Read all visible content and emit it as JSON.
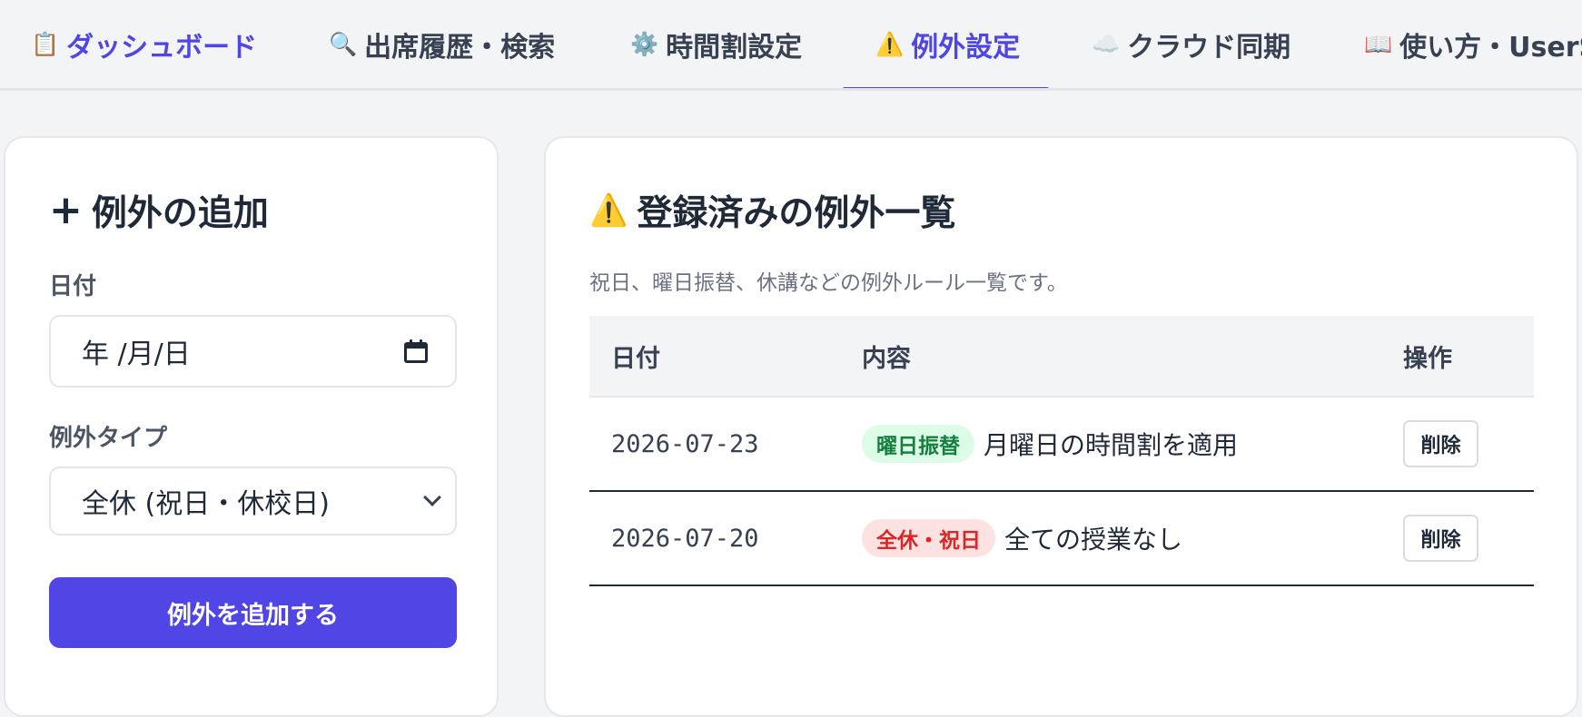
{
  "nav": {
    "tabs": [
      {
        "icon": "📋",
        "label": "ダッシュボード"
      },
      {
        "icon": "🔍",
        "label": "出席履歴・検索"
      },
      {
        "icon": "⚙️",
        "label": "時間割設定"
      },
      {
        "icon": "⚠️",
        "label": "例外設定"
      },
      {
        "icon": "☁️",
        "label": "クラウド同期"
      },
      {
        "icon": "📖",
        "label": "使い方・UserS"
      }
    ],
    "active_tab": "例外設定"
  },
  "add_form": {
    "title": "例外の追加",
    "date_label": "日付",
    "date_placeholder": "年 /月/日",
    "type_label": "例外タイプ",
    "type_selected": "全休 (祝日・休校日)",
    "submit_label": "例外を追加する"
  },
  "exceptions_list": {
    "title": "登録済みの例外一覧",
    "subtitle": "祝日、曜日振替、休講などの例外ルール一覧です。",
    "columns": [
      "日付",
      "内容",
      "操作"
    ],
    "rows": [
      {
        "date": "2026-07-23",
        "badge": "曜日振替",
        "description": "月曜日の時間割を適用",
        "action": "削除"
      },
      {
        "date": "2026-07-20",
        "badge": "全休・祝日",
        "description": "全ての授業なし",
        "action": "削除"
      }
    ]
  },
  "colors": {
    "accent": "#4f46e5",
    "badge_green_bg": "#dcfce7",
    "badge_green_text": "#15803d",
    "badge_red_bg": "#fee2e2",
    "badge_red_text": "#dc2626"
  }
}
